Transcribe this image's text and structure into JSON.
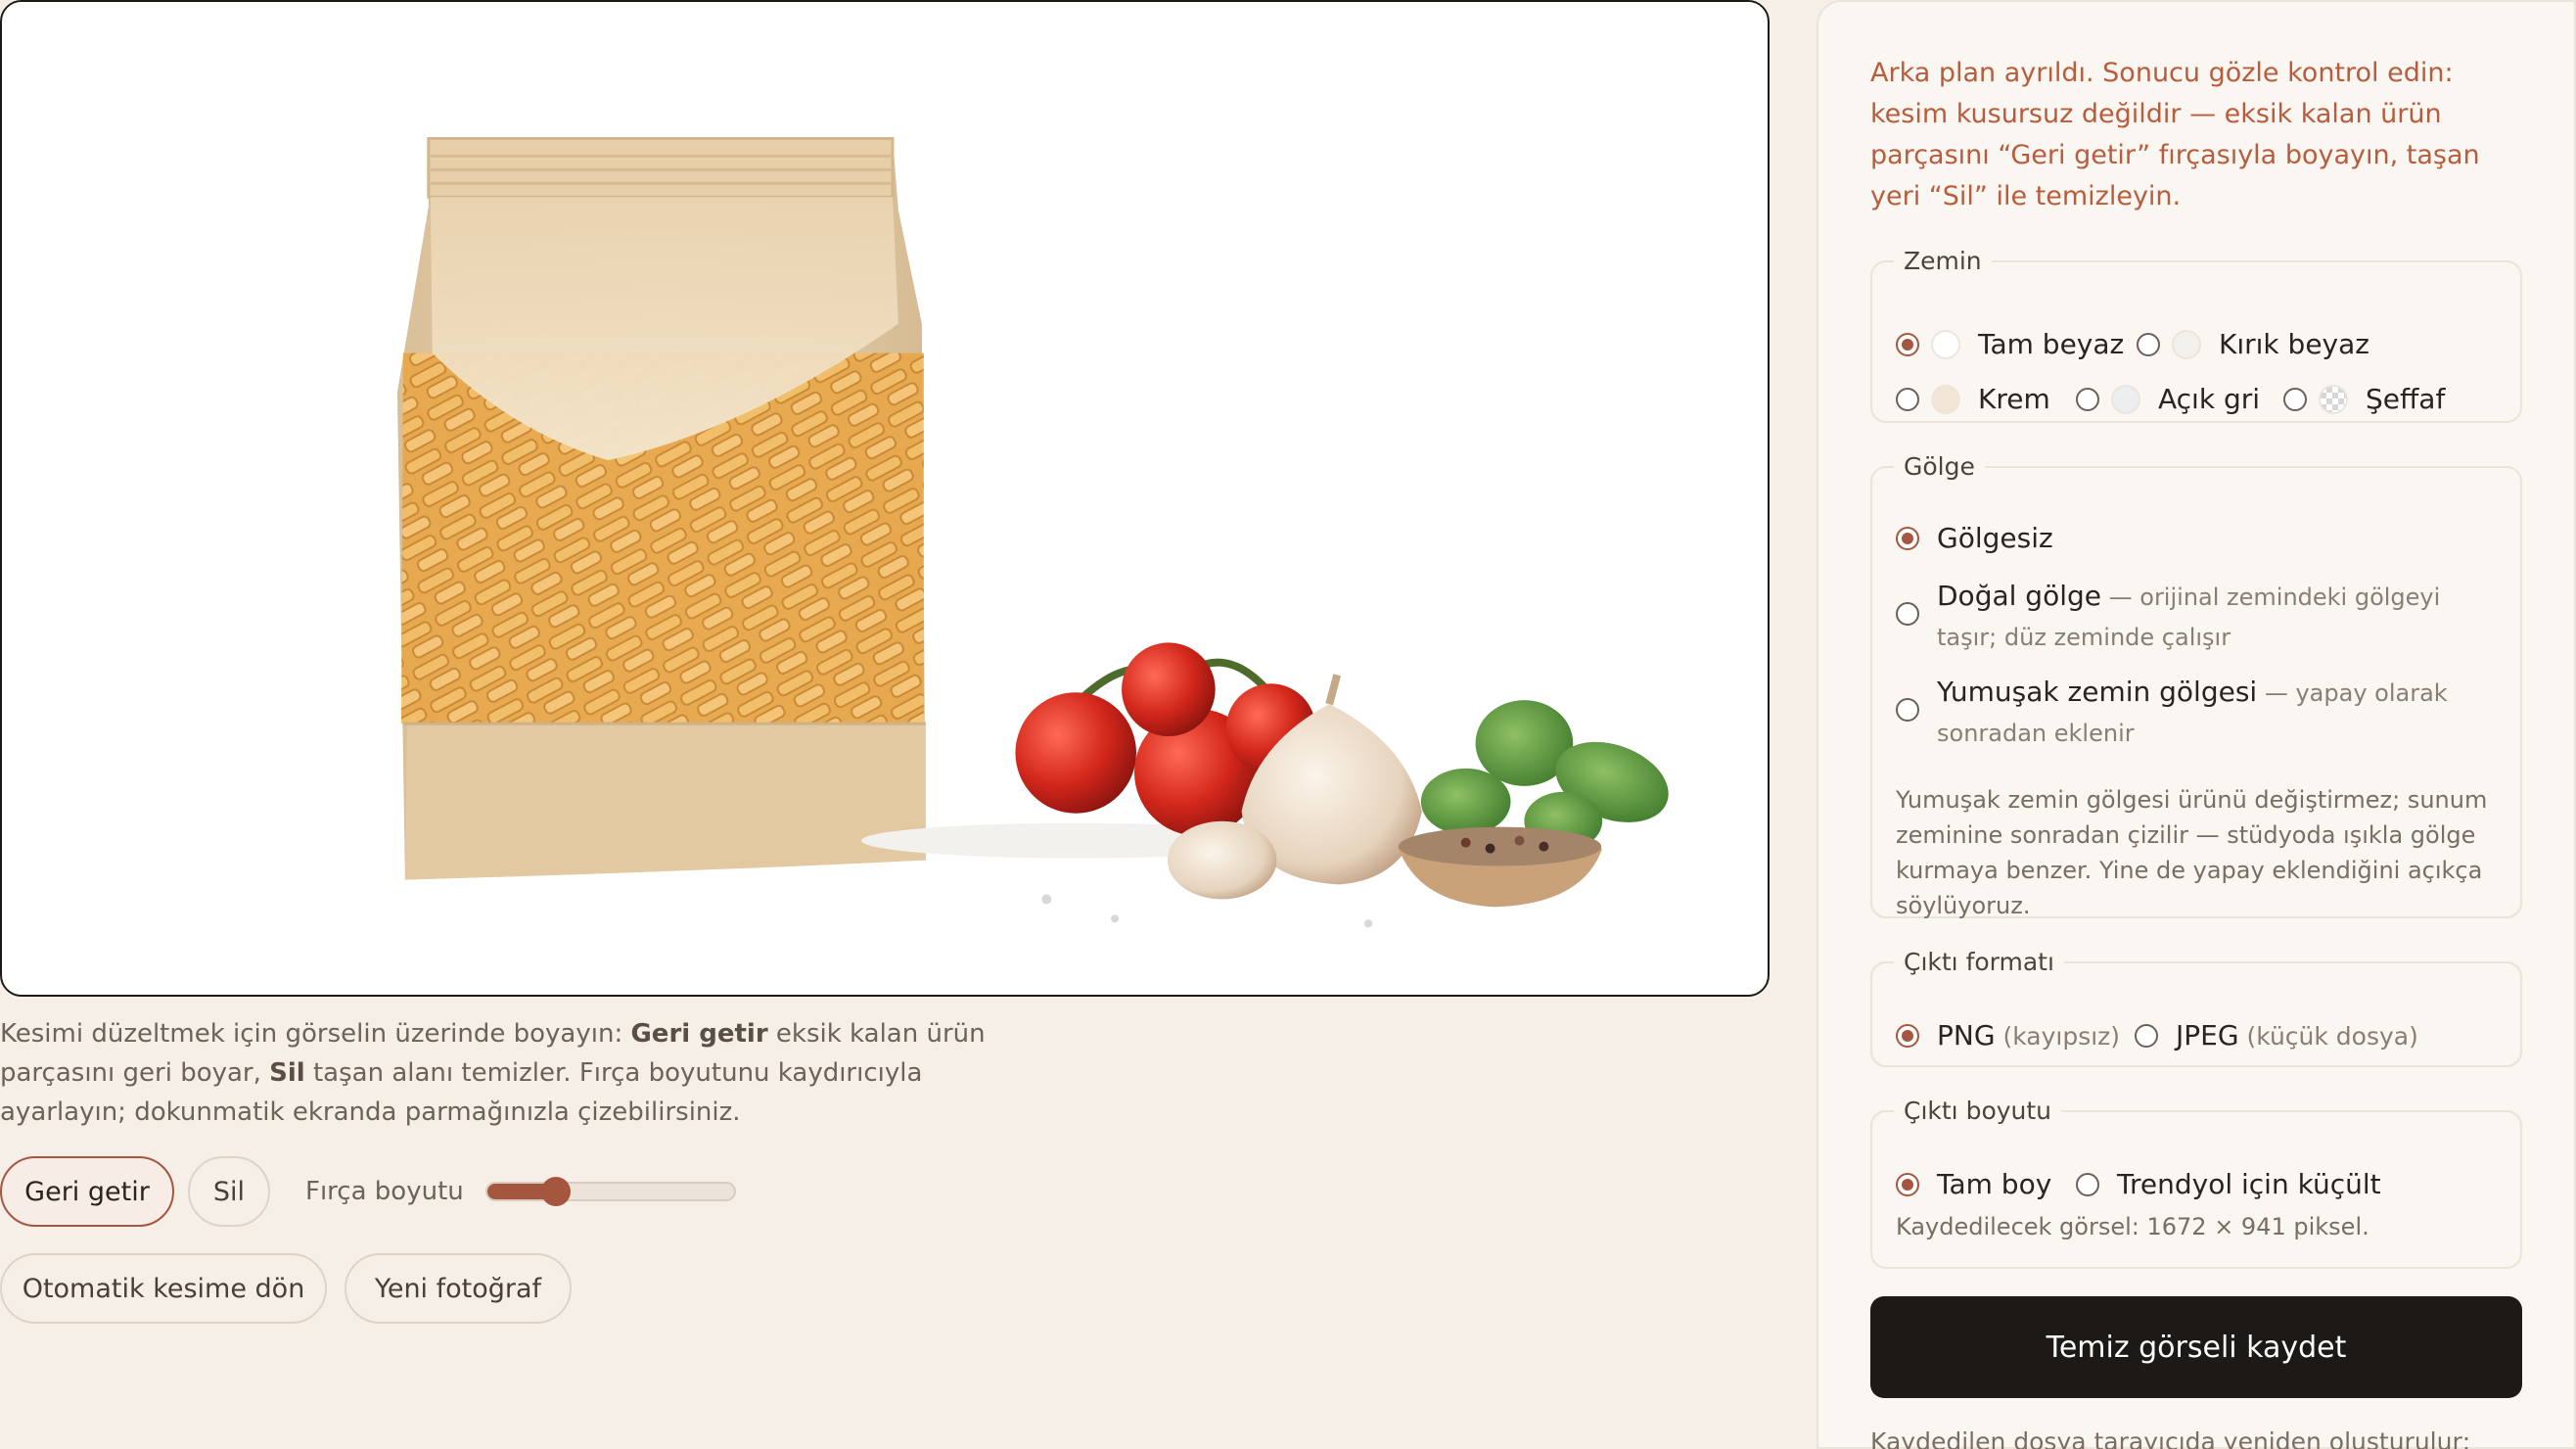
{
  "editor": {
    "image_alt": "Ürün fotoğrafı",
    "help": {
      "part1": "Kesimi düzeltmek için görselin üzerinde boyayın: ",
      "restore_word": "Geri getir",
      "part2": " eksik kalan ürün parçasını geri boyar, ",
      "erase_word": "Sil",
      "part3": " taşan alanı temizler. Fırça boyutunu kaydırıcıyla ayarlayın; dokunmatik ekranda parmağınızla çizebilirsiniz."
    },
    "tools": {
      "restore_label": "Geri getir",
      "erase_label": "Sil",
      "active_tool": "restore"
    },
    "brush": {
      "label": "Fırça boyutu",
      "value_fraction": 0.28
    },
    "actions": {
      "auto_cut_label": "Otomatik kesime dön",
      "new_photo_label": "Yeni fotoğraf"
    }
  },
  "panel": {
    "notice": "Arka plan ayrıldı. Sonucu gözle kontrol edin: kesim kusursuz değildir — eksik kalan ürün parçasını “Geri getir” fırçasıyla boyayın, taşan yeri “Sil” ile temizleyin.",
    "background": {
      "legend": "Zemin",
      "options": [
        {
          "label": "Tam beyaz",
          "color": "#ffffff",
          "selected": true
        },
        {
          "label": "Kırık beyaz",
          "color": "#f3f1ec",
          "selected": false
        },
        {
          "label": "Krem",
          "color": "#f1e6d6",
          "selected": false
        },
        {
          "label": "Açık gri",
          "color": "#eceef0",
          "selected": false
        },
        {
          "label": "Şeffaf",
          "color": "checker",
          "selected": false
        }
      ]
    },
    "shadow": {
      "legend": "Gölge",
      "options": [
        {
          "label": "Gölgesiz",
          "sub": "",
          "selected": true
        },
        {
          "label": "Doğal gölge",
          "sub": " — orijinal zemindeki gölgeyi taşır; düz zeminde çalışır",
          "selected": false
        },
        {
          "label": "Yumuşak zemin gölgesi",
          "sub": " — yapay olarak sonradan eklenir",
          "selected": false
        }
      ],
      "note": "Yumuşak zemin gölgesi ürünü değiştirmez; sunum zeminine sonradan çizilir — stüdyoda ışıkla gölge kurmaya benzer. Yine de yapay eklendiğini açıkça söylüyoruz."
    },
    "format": {
      "legend": "Çıktı formatı",
      "options": [
        {
          "label": "PNG",
          "sub": " (kayıpsız)",
          "selected": true
        },
        {
          "label": "JPEG",
          "sub": " (küçük dosya)",
          "selected": false
        }
      ]
    },
    "size": {
      "legend": "Çıktı boyutu",
      "options": [
        {
          "label": "Tam boy",
          "selected": true
        },
        {
          "label": "Trendyol için küçült",
          "selected": false
        }
      ],
      "note": "Kaydedilecek görsel: 1672 × 941 piksel."
    },
    "save_label": "Temiz görseli kaydet",
    "footer_note": "Kaydedilen dosya tarayıcıda yeniden oluşturulur;"
  },
  "colors": {
    "accent": "#a5563f",
    "notice": "#b85c3c",
    "save_button": "#1c1917"
  }
}
